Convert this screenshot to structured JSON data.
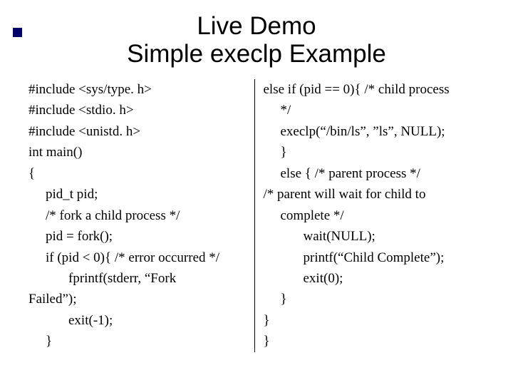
{
  "title_line1": "Live Demo",
  "title_line2": "Simple execlp Example",
  "left": {
    "l0": "#include <sys/type. h>",
    "l1": "#include <stdio. h>",
    "l2": "#include <unistd. h>",
    "l3": "int main()",
    "l4": "{",
    "l5": "pid_t pid;",
    "l6": "/* fork a child process */",
    "l7": "pid = fork();",
    "l8": "if (pid < 0){ /* error occurred */",
    "l9": "fprintf(stderr, “Fork",
    "l10": "Failed”);",
    "l11": "exit(-1);",
    "l12": "}"
  },
  "right": {
    "r0": "else if (pid == 0){ /* child process",
    "r1": "*/",
    "r2": "execlp(“/bin/ls”, ”ls”, NULL);",
    "r3": "}",
    "r4": "else { /* parent process */",
    "r5": "/* parent will wait for child to",
    "r6": "complete */",
    "r7": "wait(NULL);",
    "r8": "printf(“Child Complete”);",
    "r9": "exit(0);",
    "r10": "}",
    "r11": "}",
    "r12": "}"
  }
}
